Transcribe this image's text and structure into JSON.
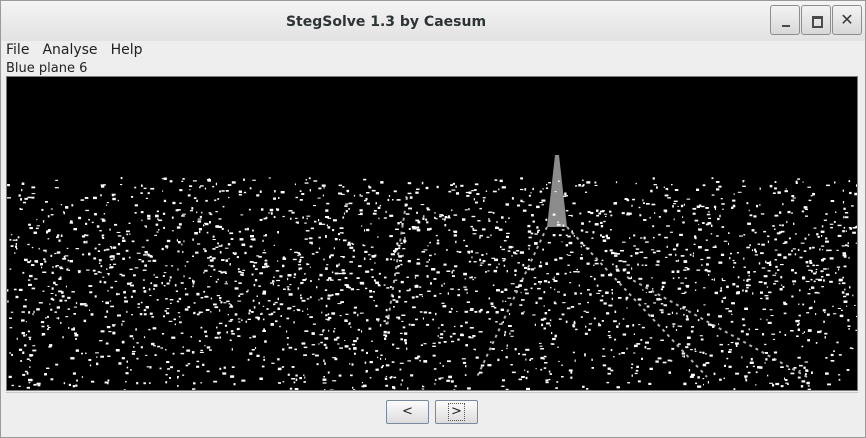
{
  "window": {
    "title": "StegSolve 1.3 by Caesum",
    "controls": [
      "minimize-icon",
      "maximize-icon",
      "close-icon"
    ]
  },
  "menu": {
    "items": [
      "File",
      "Analyse",
      "Help"
    ]
  },
  "viewer": {
    "plane_label": "Blue plane 6",
    "image_description_colors": {
      "background": "#000000",
      "foreground": "#ffffff"
    }
  },
  "navigation": {
    "prev_label": "<",
    "next_label": ">"
  }
}
